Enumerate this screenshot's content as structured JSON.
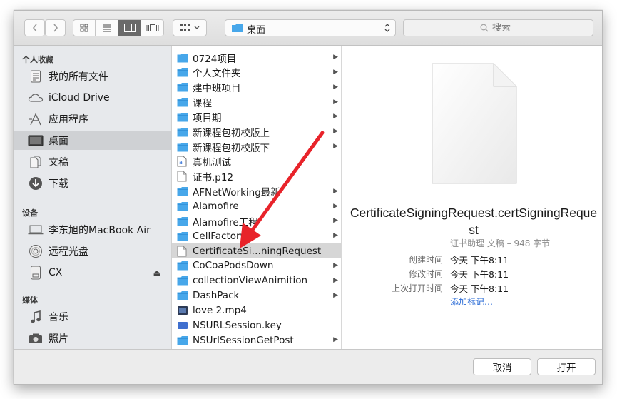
{
  "toolbar": {
    "back_icon": "chevron-left",
    "forward_icon": "chevron-right",
    "view_modes": [
      "icon",
      "list",
      "column",
      "cover-flow"
    ],
    "selected_view": "column",
    "path_label": "桌面",
    "search_placeholder": "搜索"
  },
  "sidebar": {
    "favorites_header": "个人收藏",
    "favorites": [
      {
        "label": "我的所有文件",
        "icon": "all-files-icon"
      },
      {
        "label": "iCloud Drive",
        "icon": "cloud-icon"
      },
      {
        "label": "应用程序",
        "icon": "applications-icon"
      },
      {
        "label": "桌面",
        "icon": "desktop-icon",
        "selected": true
      },
      {
        "label": "文稿",
        "icon": "documents-icon"
      },
      {
        "label": "下载",
        "icon": "downloads-icon"
      }
    ],
    "devices_header": "设备",
    "devices": [
      {
        "label": "李东旭的MacBook Air",
        "icon": "laptop-icon"
      },
      {
        "label": "远程光盘",
        "icon": "disc-icon"
      },
      {
        "label": "CX",
        "icon": "drive-icon",
        "eject": "⏏"
      }
    ],
    "media_header": "媒体",
    "media": [
      {
        "label": "音乐",
        "icon": "music-icon"
      },
      {
        "label": "照片",
        "icon": "camera-icon"
      }
    ]
  },
  "files": [
    {
      "name": "0724项目",
      "type": "folder",
      "arrow": "▶"
    },
    {
      "name": "个人文件夹",
      "type": "folder",
      "arrow": "▶"
    },
    {
      "name": "建中班项目",
      "type": "folder",
      "arrow": "▶"
    },
    {
      "name": "课程",
      "type": "folder",
      "arrow": "▶"
    },
    {
      "name": "项目期",
      "type": "folder",
      "arrow": "▶"
    },
    {
      "name": "新课程包初校版上",
      "type": "folder",
      "arrow": "▶"
    },
    {
      "name": "新课程包初校版下",
      "type": "folder",
      "arrow": "▶"
    },
    {
      "name": "真机测试",
      "type": "text",
      "arrow": ""
    },
    {
      "name": "证书.p12",
      "type": "doc",
      "arrow": ""
    },
    {
      "name": "AFNetWorking最新",
      "type": "folder",
      "arrow": "▶"
    },
    {
      "name": "Alamofire",
      "type": "folder",
      "arrow": "▶"
    },
    {
      "name": "Alamofire工程",
      "type": "folder",
      "arrow": "▶"
    },
    {
      "name": "CellFactory",
      "type": "folder",
      "arrow": "▶"
    },
    {
      "name": "CertificateSi…ningRequest",
      "type": "doc",
      "arrow": "",
      "selected": true
    },
    {
      "name": "CoCoaPodsDown",
      "type": "folder",
      "arrow": "▶"
    },
    {
      "name": "collectionViewAnimition",
      "type": "folder",
      "arrow": "▶"
    },
    {
      "name": "DashPack",
      "type": "folder",
      "arrow": "▶"
    },
    {
      "name": "love 2.mp4",
      "type": "video",
      "arrow": ""
    },
    {
      "name": "NSURLSession.key",
      "type": "key",
      "arrow": ""
    },
    {
      "name": "NSUrlSessionGetPost",
      "type": "folder",
      "arrow": "▶"
    }
  ],
  "preview": {
    "file_name": "CertificateSigningRequest.certSigningRequest",
    "kind": "证书助理 文稿 – 948 字节",
    "meta": [
      {
        "key": "创建时间",
        "value": "今天 下午8:11"
      },
      {
        "key": "修改时间",
        "value": "今天 下午8:11"
      },
      {
        "key": "上次打开时间",
        "value": "今天 下午8:11"
      }
    ],
    "add_tag": "添加标记…"
  },
  "buttons": {
    "cancel": "取消",
    "open": "打开"
  },
  "colors": {
    "folder": "#47a7ea",
    "selection_gray": "#d6d6d6",
    "link": "#2a6bd6",
    "annotation_arrow": "#e8232a"
  }
}
